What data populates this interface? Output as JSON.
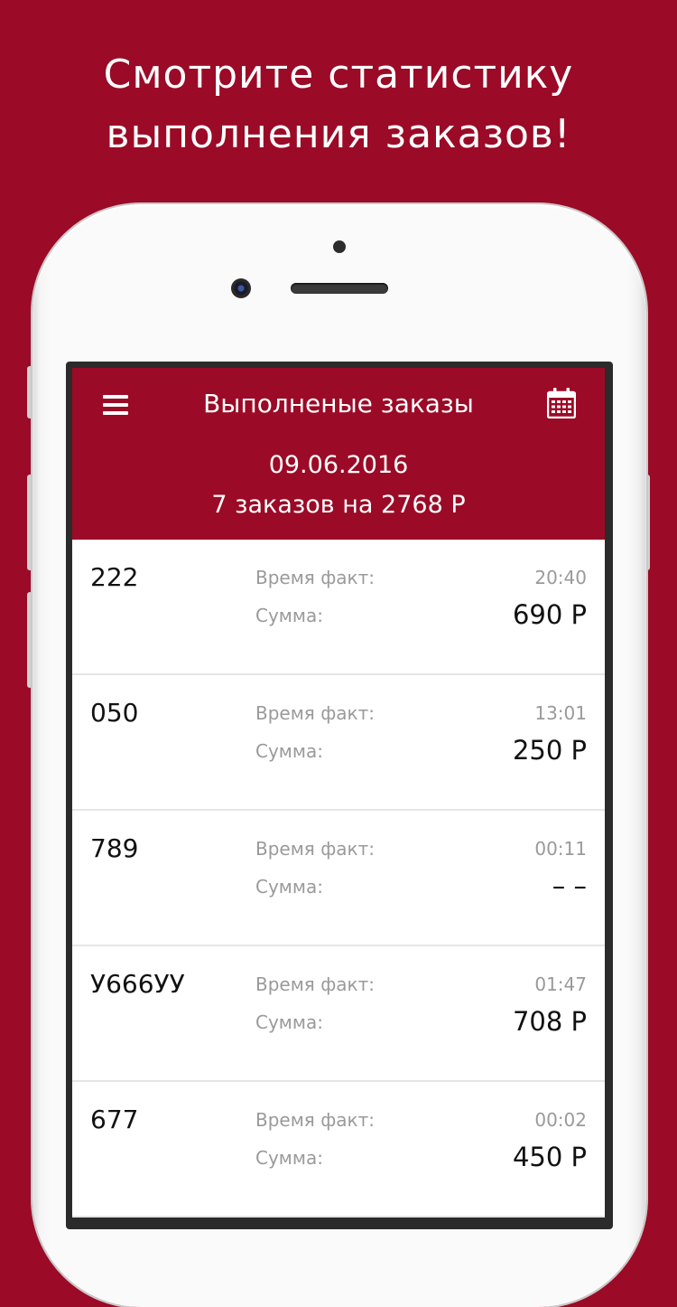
{
  "promo": {
    "line1": "Смотрите статистику",
    "line2": "выполнения заказов!"
  },
  "header": {
    "title": "Выполненые заказы",
    "date": "09.06.2016",
    "summary": "7 заказов на 2768 Р",
    "menu_icon": "hamburger-menu-icon",
    "calendar_icon": "calendar-icon"
  },
  "labels": {
    "time": "Время факт:",
    "sum": "Сумма:"
  },
  "orders": [
    {
      "id": "222",
      "time": "20:40",
      "sum": "690 Р"
    },
    {
      "id": "050",
      "time": "13:01",
      "sum": "250 Р"
    },
    {
      "id": "789",
      "time": "00:11",
      "sum": "– –"
    },
    {
      "id": "У666УУ",
      "time": "01:47",
      "sum": "708 Р"
    },
    {
      "id": "677",
      "time": "00:02",
      "sum": "450 Р"
    }
  ],
  "colors": {
    "brand": "#9b0a26",
    "label_gray": "#9a9a9a",
    "divider": "#e6e6e6"
  }
}
